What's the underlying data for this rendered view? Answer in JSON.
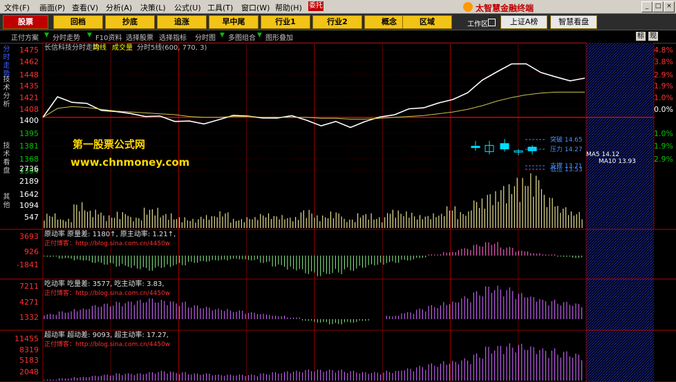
{
  "menu": {
    "items": [
      {
        "label": "文件(F)"
      },
      {
        "label": "画面(P)"
      },
      {
        "label": "查看(V)"
      },
      {
        "label": "分析(A)"
      },
      {
        "label": "决策(L)"
      },
      {
        "label": "公式(U)"
      },
      {
        "label": "工具(T)"
      },
      {
        "label": "窗口(W)"
      },
      {
        "label": "帮助(H)"
      }
    ],
    "wt_label": "委托",
    "brand": "太智慧金融终端"
  },
  "toolbar": {
    "buttons": [
      {
        "label": "股票"
      },
      {
        "label": "回档"
      },
      {
        "label": "抄底"
      },
      {
        "label": "追涨"
      },
      {
        "label": "早中尾"
      },
      {
        "label": "行业1"
      },
      {
        "label": "行业2"
      },
      {
        "label": "概念"
      },
      {
        "label": "区域"
      }
    ],
    "workspace": "工作区",
    "index_button": "上证A榜",
    "smart_button": "智慧看盘"
  },
  "subbar": {
    "items": [
      {
        "label": "正付方案"
      },
      {
        "label": "分时走势"
      },
      {
        "label": "F10资料"
      },
      {
        "label": "选择股票"
      },
      {
        "label": "选择指标"
      },
      {
        "label": "分时图"
      },
      {
        "label": "多图组合"
      },
      {
        "label": "图形叠加"
      }
    ],
    "right": [
      "标",
      "现"
    ]
  },
  "side_tabs": [
    {
      "label": "分时走势"
    },
    {
      "label": "技术分析"
    },
    {
      "label": "技术看盘"
    },
    {
      "label": "其他"
    }
  ],
  "chart_header": {
    "name": "长信科技分时走势",
    "ma_label": "均线",
    "vol_label": "成交量",
    "ma_params": "分时5线(600, 770, 3)"
  },
  "watermark": {
    "line1": "第一股票公式网",
    "line2": "www.chnmoney.com"
  },
  "colors": {
    "up": "#ff3030",
    "down": "#00c800",
    "grid": "#8b0000",
    "price_line": "#ffffff",
    "avg_line": "#c8c850",
    "accent": "#f2c418"
  },
  "chart_data": [
    {
      "type": "line",
      "title": "长信科技分时走势",
      "y_labels_left": [
        "1475",
        "1462",
        "1448",
        "1435",
        "1421",
        "1408",
        "1400",
        "1395",
        "1381",
        "1368",
        "1354",
        "2736",
        "2189",
        "1642",
        "1094",
        "547"
      ],
      "y_labels_right": [
        "4.8%",
        "3.8%",
        "2.9%",
        "1.9%",
        "1.0%",
        "0.0%",
        "1.0%",
        "1.9%",
        "2.9%",
        "3.8%"
      ],
      "ylim": [
        1354,
        1475
      ],
      "base": 1400,
      "series": [
        {
          "name": "",
          "type": "line",
          "values": [
            1400,
            1422,
            1418,
            1414,
            1409,
            1406,
            1404,
            1402,
            1400,
            1397,
            1395,
            1393,
            1398,
            1401,
            1403,
            1398,
            1400,
            1402,
            1396,
            1392,
            1394,
            1390,
            1395,
            1400,
            1404,
            1408,
            1412,
            1415,
            1420,
            1428,
            1440,
            1452,
            1458,
            1460,
            1450,
            1444,
            1442,
            1442
          ]
        },
        {
          "name": "均线",
          "type": "line",
          "values": [
            1400,
            1410,
            1412,
            1411,
            1409,
            1407,
            1406,
            1405,
            1404,
            1403,
            1401,
            1400,
            1400,
            1401,
            1401,
            1400,
            1400,
            1400,
            1400,
            1399,
            1399,
            1398,
            1398,
            1399,
            1400,
            1401,
            1402,
            1404,
            1406,
            1409,
            1413,
            1418,
            1422,
            1425,
            1427,
            1428,
            1428,
            1428
          ]
        }
      ],
      "candles": [
        {
          "open": 1368,
          "close": 1368,
          "high": 1363,
          "low": 1374
        },
        {
          "open": 1362,
          "close": 1369,
          "high": 1359,
          "low": 1374
        },
        {
          "open": 1365,
          "close": 1371,
          "high": 1362,
          "low": 1376
        },
        {
          "open": 1362,
          "close": 1363,
          "high": 1358,
          "low": 1365
        },
        {
          "open": 1363,
          "close": 1367,
          "high": 1359,
          "low": 1369
        }
      ],
      "annotations": [
        "突破 14.65",
        "压力 14.27",
        "MA5 14.12",
        "MA10 13.93",
        "支撑 13.71",
        "低位 13.53"
      ]
    },
    {
      "type": "bar",
      "title": "成交量",
      "values": [
        8,
        5,
        14,
        10,
        7,
        9,
        6,
        11,
        8,
        6,
        5,
        7,
        9,
        5,
        6,
        8,
        7,
        6,
        10,
        7,
        9,
        5,
        8,
        6,
        10,
        9,
        7,
        8,
        12,
        9,
        16,
        20,
        24,
        28,
        30,
        18,
        12,
        9
      ]
    },
    {
      "type": "bar",
      "title": "原动率",
      "y_labels": [
        "3693",
        "926",
        "-1841"
      ],
      "label_text": "原动率  原量差: 1180↑, 原主动率: 1.21↑,",
      "blog": "正付博客：http://blog.sina.com.cn/4450w",
      "values": [
        -2,
        -5,
        -8,
        -12,
        -15,
        -18,
        -22,
        -25,
        -20,
        -16,
        -12,
        -10,
        -8,
        -6,
        -8,
        -12,
        -18,
        -24,
        -30,
        -34,
        -30,
        -25,
        -20,
        -16,
        -12,
        -8,
        -4,
        2,
        6,
        12,
        18,
        22,
        14,
        8,
        4,
        2,
        -2,
        -4
      ]
    },
    {
      "type": "bar",
      "title": "吃动率",
      "y_labels": [
        "7211",
        "4271",
        "1332"
      ],
      "label_text": "吃动率  吃量差: 3577, 吃主动率: 3.83,",
      "blog": "正付博客：http://blog.sina.com.cn/4450w",
      "values": [
        6,
        9,
        12,
        16,
        18,
        20,
        22,
        24,
        22,
        20,
        16,
        14,
        12,
        10,
        8,
        6,
        4,
        2,
        -2,
        -4,
        -6,
        -4,
        -2,
        0,
        4,
        8,
        12,
        16,
        20,
        26,
        32,
        38,
        36,
        30,
        26,
        22,
        20,
        18
      ]
    },
    {
      "type": "bar",
      "title": "超动率",
      "y_labels": [
        "11455",
        "8319",
        "5183",
        "2048"
      ],
      "label_text": "超动率  超动差: 9093, 超主动率: 17.27,",
      "blog": "正付博客：http://blog.sina.com.cn/4450w",
      "values": [
        1,
        2,
        3,
        4,
        5,
        6,
        6,
        7,
        8,
        7,
        6,
        6,
        5,
        5,
        5,
        6,
        7,
        8,
        9,
        9,
        9,
        8,
        7,
        7,
        8,
        10,
        12,
        14,
        16,
        18,
        22,
        28,
        30,
        30,
        28,
        26,
        24,
        22
      ]
    }
  ]
}
